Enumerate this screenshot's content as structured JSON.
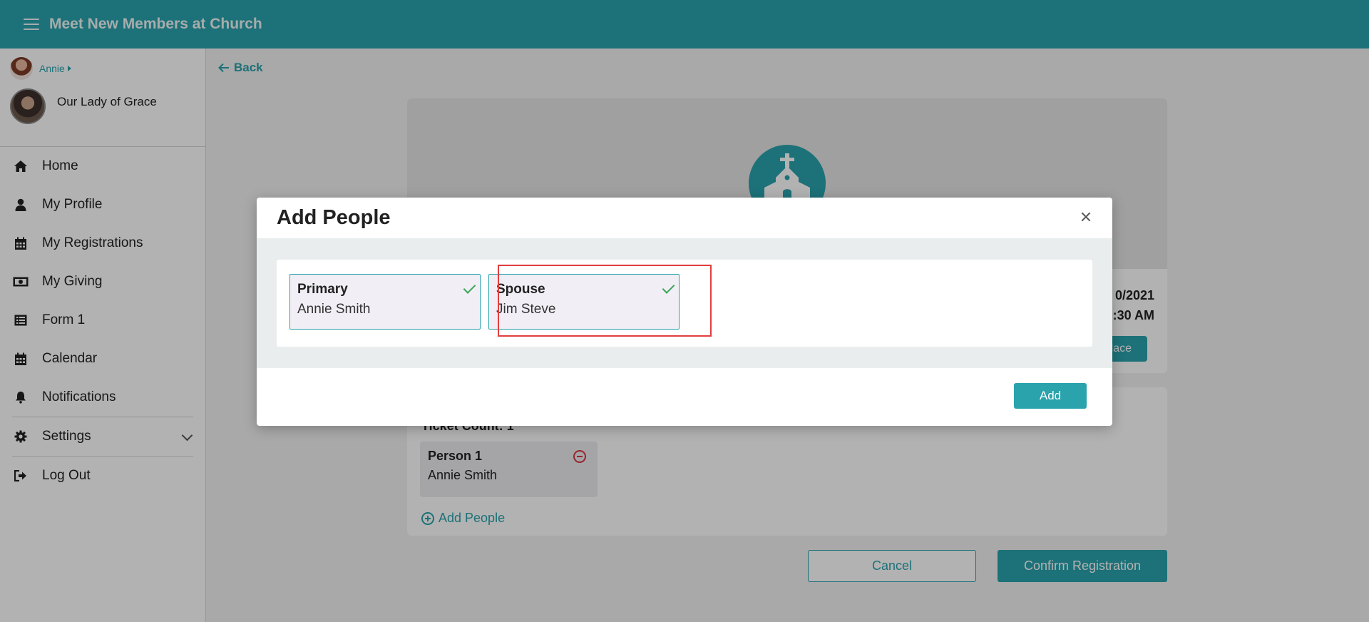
{
  "header": {
    "title": "Meet New Members at Church"
  },
  "sidebar": {
    "user_name": "Annie",
    "church_name": "Our Lady of Grace",
    "items": [
      {
        "label": "Home",
        "icon": "home-icon"
      },
      {
        "label": "My Profile",
        "icon": "user-icon"
      },
      {
        "label": "My Registrations",
        "icon": "calendar-icon"
      },
      {
        "label": "My Giving",
        "icon": "money-icon"
      },
      {
        "label": "Form 1",
        "icon": "list-icon"
      },
      {
        "label": "Calendar",
        "icon": "calendar-icon"
      },
      {
        "label": "Notifications",
        "icon": "bell-icon"
      }
    ],
    "settings_label": "Settings",
    "logout_label": "Log Out"
  },
  "main": {
    "back_label": "Back",
    "event_date_line1": "0/2021",
    "event_date_line2": ":30 AM",
    "replace_label": "lace",
    "ticket_count_label": "Ticket Count: 1",
    "person": {
      "label": "Person 1",
      "name": "Annie Smith"
    },
    "add_people_label": "Add People",
    "cancel_label": "Cancel",
    "confirm_label": "Confirm Registration"
  },
  "modal": {
    "title": "Add People",
    "options": [
      {
        "label": "Primary",
        "name": "Annie Smith",
        "selected": true
      },
      {
        "label": "Spouse",
        "name": "Jim Steve",
        "selected": true
      }
    ],
    "add_label": "Add"
  },
  "colors": {
    "accent": "#2aa3ad",
    "highlight": "#e23e3e",
    "check": "#3aa55a",
    "danger": "#d9343f"
  }
}
